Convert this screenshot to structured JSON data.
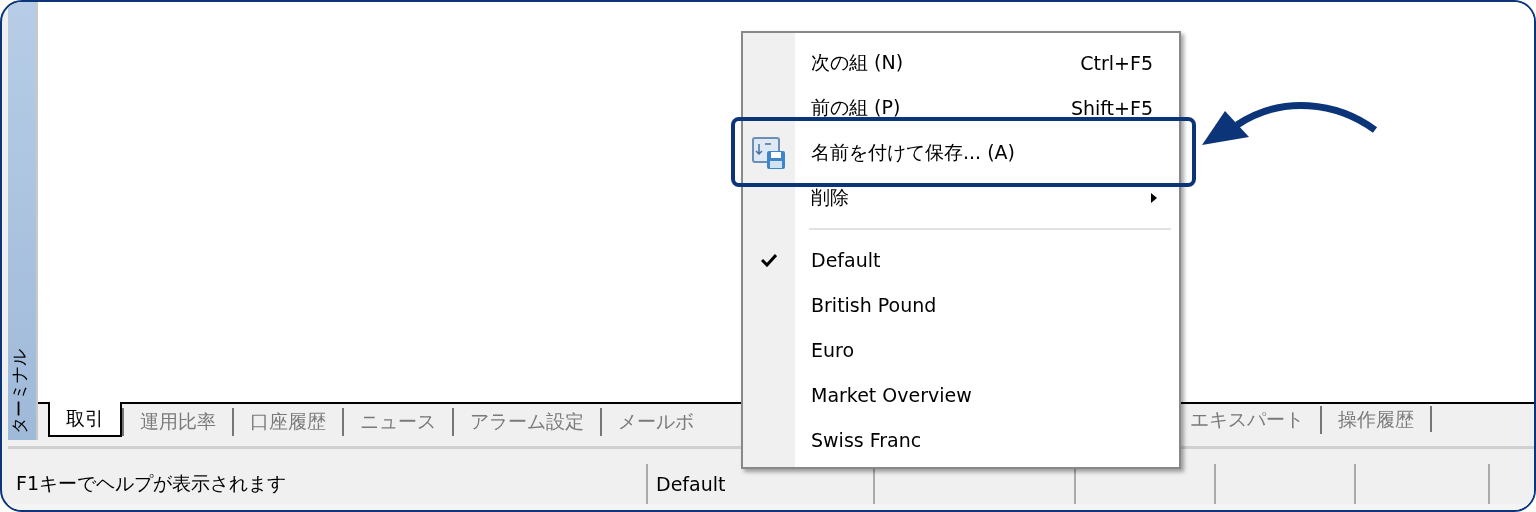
{
  "side_panel": {
    "title": "ターミナル"
  },
  "tab_bar": {
    "tabs_left": [
      {
        "label": "取引",
        "selected": true
      },
      {
        "label": "運用比率",
        "selected": false
      },
      {
        "label": "口座履歴",
        "selected": false
      },
      {
        "label": "ニュース",
        "selected": false
      },
      {
        "label": "アラーム設定",
        "selected": false
      },
      {
        "label": "メールボ",
        "selected": false
      }
    ],
    "tabs_right": [
      {
        "label": "エキスパート",
        "selected": false
      },
      {
        "label": "操作履歴",
        "selected": false
      }
    ]
  },
  "status_bar": {
    "segments": [
      "F1キーでヘルプが表示されます",
      "Default"
    ]
  },
  "context_menu": {
    "items": [
      {
        "kind": "command",
        "label": "次の組 (N)",
        "shortcut": "Ctrl+F5",
        "submenu": false
      },
      {
        "kind": "command",
        "label": "前の組 (P)",
        "shortcut": "Shift+F5",
        "submenu": false
      },
      {
        "kind": "command",
        "label": "名前を付けて保存... (A)",
        "submenu": false
      },
      {
        "kind": "command",
        "label": "削除",
        "submenu": true
      },
      {
        "kind": "separator"
      },
      {
        "kind": "option",
        "label": "Default",
        "checked": true
      },
      {
        "kind": "option",
        "label": "British Pound",
        "checked": false
      },
      {
        "kind": "option",
        "label": "Euro",
        "checked": false
      },
      {
        "kind": "option",
        "label": "Market Overview",
        "checked": false
      },
      {
        "kind": "option",
        "label": "Swiss Franc",
        "checked": false
      }
    ]
  }
}
